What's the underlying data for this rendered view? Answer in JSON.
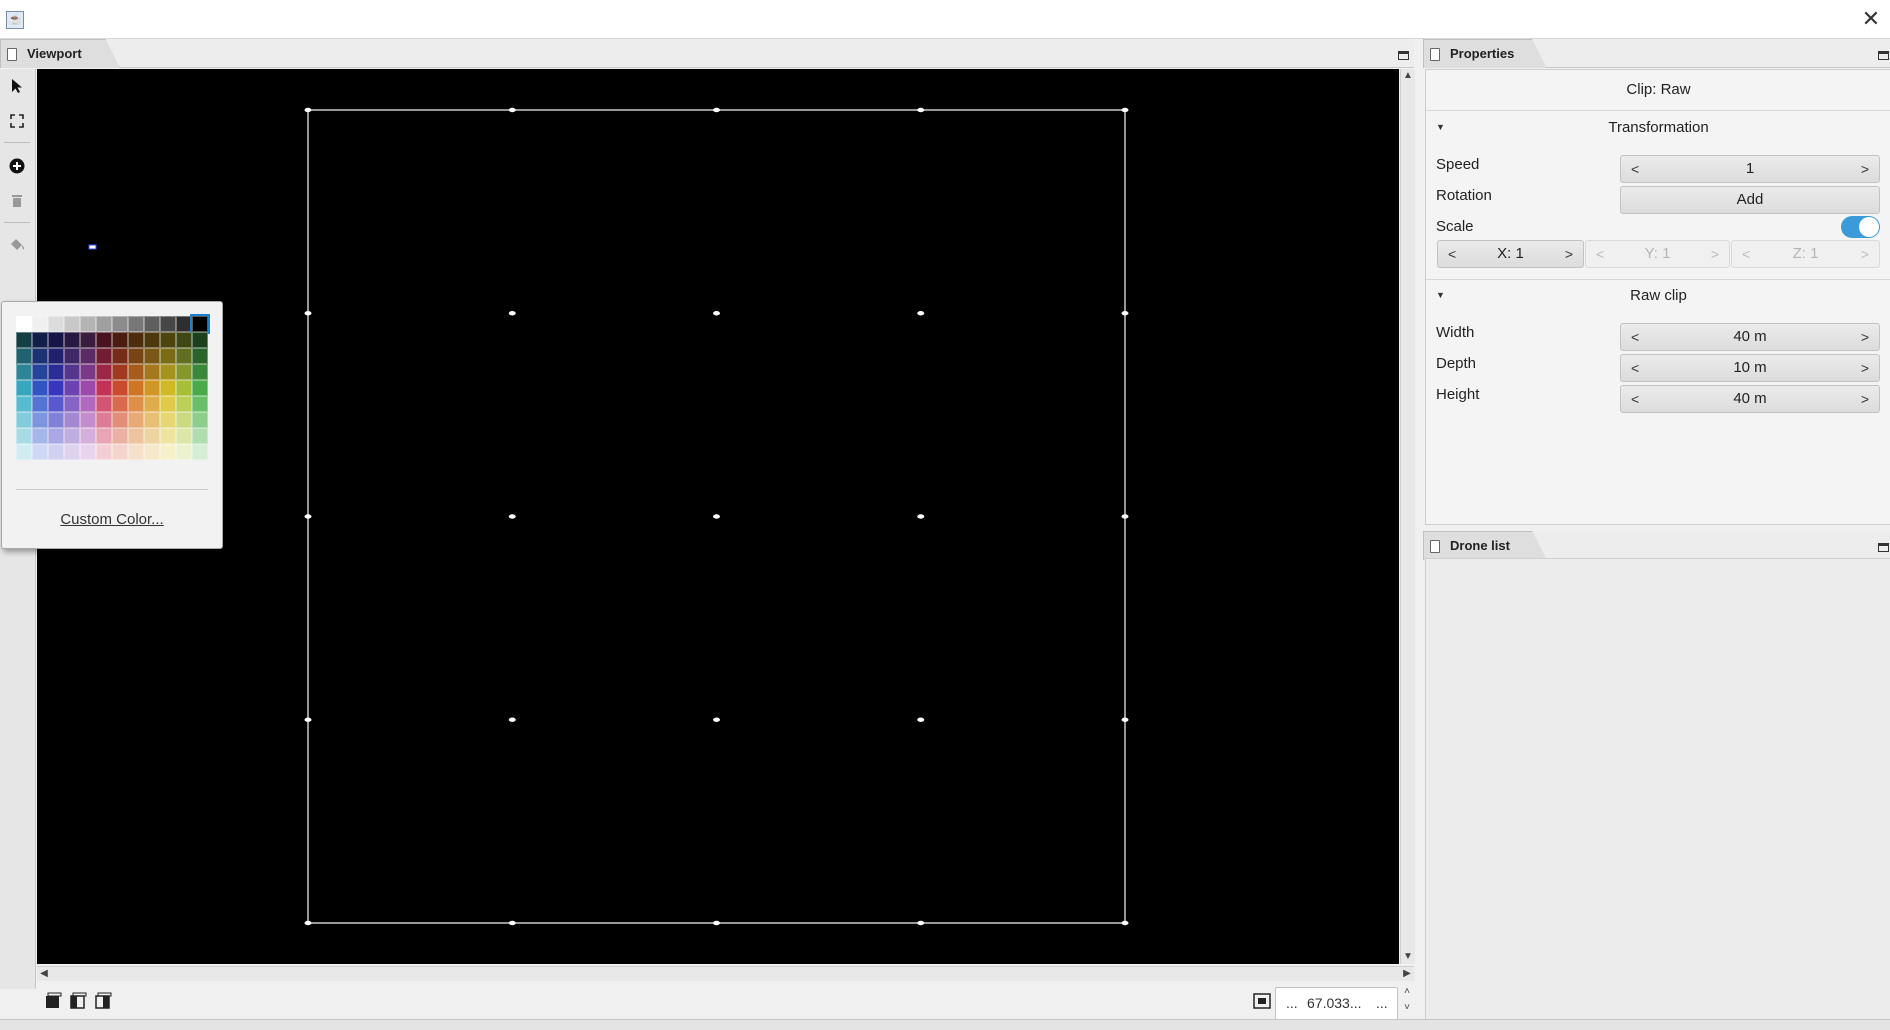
{
  "window": {
    "close_glyph": "✕"
  },
  "viewport": {
    "tab_label": "Viewport",
    "zoom_text": "67.033...",
    "zoom_dots_left": "...",
    "zoom_dots_right": "...",
    "background": "#000000"
  },
  "toolbar": {
    "tools": [
      "select-arrow-icon",
      "fit-view-icon",
      "add-circle-icon",
      "trash-icon",
      "paint-bucket-icon"
    ],
    "current_color": "#000000"
  },
  "color_picker": {
    "custom_color_label": "Custom Color..."
  },
  "properties": {
    "tab_label": "Properties",
    "clip_title": "Clip: Raw",
    "transformation": {
      "header": "Transformation",
      "speed_label": "Speed",
      "speed_value": "1",
      "rotation_label": "Rotation",
      "rotation_button": "Add",
      "scale_label": "Scale",
      "scale_toggle_on": true,
      "scale_x": "X: 1",
      "scale_y": "Y: 1",
      "scale_z": "Z: 1"
    },
    "raw_clip": {
      "header": "Raw clip",
      "width_label": "Width",
      "width_value": "40 m",
      "depth_label": "Depth",
      "depth_value": "10 m",
      "height_label": "Height",
      "height_value": "40 m"
    },
    "spinner_prev": "<",
    "spinner_next": ">"
  },
  "drone_list": {
    "tab_label": "Drone list"
  },
  "colors": {
    "accent": "#3a9bd8"
  }
}
